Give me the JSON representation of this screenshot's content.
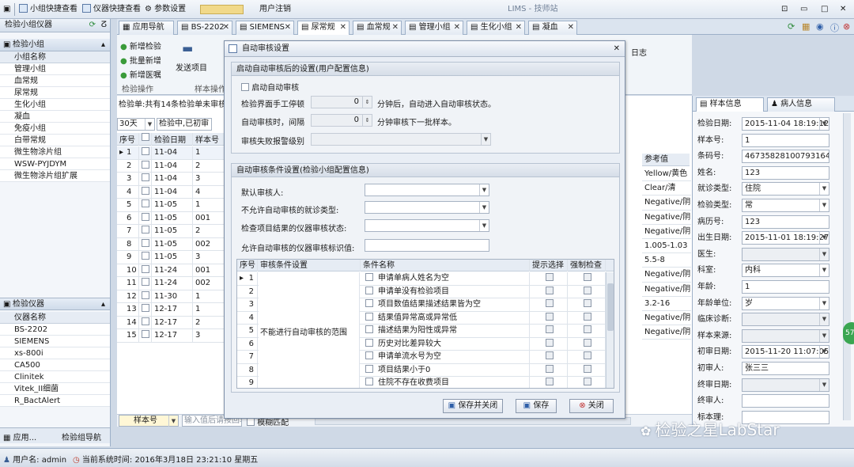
{
  "app": {
    "title": "LIMS - 技师站"
  },
  "toolbar": {
    "items": [
      "小组快捷查看",
      "仪器快捷查看",
      "参数设置",
      "用户注销"
    ]
  },
  "tabs": [
    "应用导航",
    "BS-2202",
    "SIEMENS",
    "尿常规",
    "血常规",
    "管理小组",
    "生化小组",
    "凝血"
  ],
  "left": {
    "title": "检验小组仪器",
    "group_panel_title": "检验小组",
    "group_col": "小组名称",
    "groups": [
      "管理小组",
      "血常规",
      "尿常规",
      "生化小组",
      "凝血",
      "免疫小组",
      "白带常规",
      "微生物涂片组",
      "WSW-PYJDYM",
      "微生物涂片组扩展"
    ],
    "instr_panel_title": "检验仪器",
    "instr_col": "仪器名称",
    "instruments": [
      "BS-2202",
      "SIEMENS",
      "xs-800i",
      "CA500",
      "Clinitek",
      "Vitek_II细菌",
      "R_BactAlert"
    ],
    "bottom_tabs": [
      "应用...",
      "检验组导航"
    ]
  },
  "ribbon": {
    "new_check": "新增检验",
    "batch_add": "批量新增",
    "new_order": "新增医嘱",
    "group_label": "检验操作",
    "send_items": "发送项目",
    "sample_ops": "样本操作",
    "log": "日志"
  },
  "grid": {
    "summary": "检验单:共有14条检验单未审核",
    "filter_days": "30天",
    "filter_status": "检验中,已初审",
    "columns": [
      "序号",
      "检验日期",
      "样本号"
    ],
    "rows": [
      [
        "1",
        "11-04",
        "1"
      ],
      [
        "2",
        "11-04",
        "2"
      ],
      [
        "3",
        "11-04",
        "3"
      ],
      [
        "4",
        "11-04",
        "4"
      ],
      [
        "5",
        "11-05",
        "1"
      ],
      [
        "6",
        "11-05",
        "001"
      ],
      [
        "7",
        "11-05",
        "2"
      ],
      [
        "8",
        "11-05",
        "002"
      ],
      [
        "9",
        "11-05",
        "3"
      ],
      [
        "10",
        "11-24",
        "001"
      ],
      [
        "11",
        "11-24",
        "002"
      ],
      [
        "12",
        "11-30",
        "1"
      ],
      [
        "13",
        "12-17",
        "1"
      ],
      [
        "14",
        "12-17",
        "2"
      ],
      [
        "15",
        "12-17",
        "3"
      ]
    ],
    "ref_header": "参考值",
    "ref_values": [
      "Yellow/黄色",
      "Clear/清",
      "Negative/阴",
      "Negative/阴",
      "Negative/阴",
      "1.005-1.03",
      "5.5-8",
      "Negative/阴",
      "Negative/阴",
      "3.2-16",
      "Negative/阴",
      "Negative/阴"
    ],
    "search_field": "样本号",
    "search_placeholder": "输入值后请按回车",
    "fuzzy": "模糊匹配"
  },
  "dialog": {
    "title": "自动审核设置",
    "g1_title": "启动自动审核后的设置(用户配置信息)",
    "enable_auto": "启动自动审核",
    "idle_label": "检验界面手工停顿",
    "idle_value": "0",
    "idle_suffix": "分钟后，自动进入自动审核状态。",
    "interval_label": "自动审核时，间隔",
    "interval_value": "0",
    "interval_suffix": "分钟审核下一批样本。",
    "fail_label": "审核失败报警级别",
    "g2_title": "自动审核条件设置(检验小组配置信息)",
    "default_reviewer": "默认审核人:",
    "disallow_visit": "不允许自动审核的就诊类型:",
    "instr_status": "检查项目结果的仪器审核状态:",
    "allow_flag": "允许自动审核的仪器审核标识值:",
    "table_cols": [
      "序号",
      "审核条件设置",
      "条件名称",
      "提示选择",
      "强制检查"
    ],
    "merged_condition": "不能进行自动审核的范围",
    "conditions": [
      "申请单病人姓名为空",
      "申请单没有检验项目",
      "项目数值结果描述结果皆为空",
      "结果值异常高或异常低",
      "描述结果为阳性或异常",
      "历史对比差异较大",
      "申请单流水号为空",
      "项目结果小于0",
      "住院不存在收费项目"
    ],
    "btn_save_close": "保存并关闭",
    "btn_save": "保存",
    "btn_close": "关闭"
  },
  "right": {
    "tab1": "样本信息",
    "tab2": "病人信息",
    "fields": [
      {
        "label": "检验日期:",
        "value": "2015-11-04 18:19:12",
        "combo": true
      },
      {
        "label": "样本号:",
        "value": "1"
      },
      {
        "label": "条码号:",
        "value": "4673582810079316434"
      },
      {
        "label": "姓名:",
        "value": "123"
      },
      {
        "label": "就诊类型:",
        "value": "住院",
        "combo": true
      },
      {
        "label": "检验类型:",
        "value": "常",
        "combo": true
      },
      {
        "label": "病历号:",
        "value": "123"
      },
      {
        "label": "出生日期:",
        "value": "2015-11-01 18:19:27",
        "combo": true
      },
      {
        "label": "医生:",
        "value": "",
        "combo": true
      },
      {
        "label": "科室:",
        "value": "内科",
        "combo": true
      },
      {
        "label": "年龄:",
        "value": "1"
      },
      {
        "label": "年龄单位:",
        "value": "岁",
        "combo": true
      },
      {
        "label": "临床诊断:",
        "value": "",
        "combo": true
      },
      {
        "label": "样本来源:",
        "value": "",
        "combo": true
      },
      {
        "label": "初审日期:",
        "value": "2015-11-20 11:07:05",
        "combo": true
      },
      {
        "label": "初审人:",
        "value": "张三三"
      },
      {
        "label": "终审日期:",
        "value": "",
        "combo": true
      },
      {
        "label": "终审人:",
        "value": ""
      },
      {
        "label": "标本理:",
        "value": ""
      }
    ],
    "badge": "57"
  },
  "status": {
    "user_label": "用户名:",
    "user": "admin",
    "time_label": "当前系统时间:",
    "time": "2016年3月18日 23:21:10 星期五"
  },
  "watermark": "检验之星LabStar"
}
